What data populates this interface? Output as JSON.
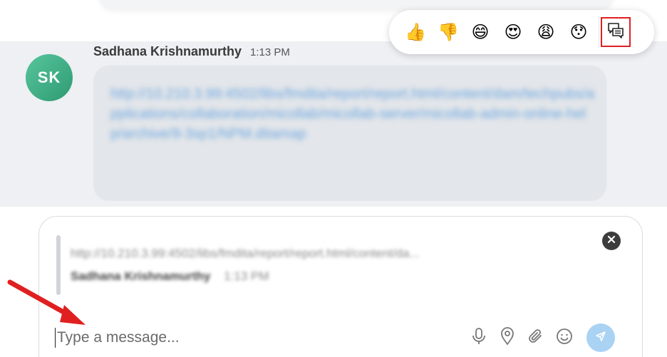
{
  "message": {
    "avatar_initials": "SK",
    "sender_name": "Sadhana Krishnamurthy",
    "time": "1:13 PM",
    "link_text": "http://10.210.3.99:4502/libs/fmdita/report/report.html/content/dam/techpubs/applications/collaboration/micollab/micollab-server/micollab-admin-online-help/archive/9-3sp1/NPM.ditamap"
  },
  "reactions": {
    "items": [
      {
        "name": "thumbs-up",
        "glyph": "👍"
      },
      {
        "name": "thumbs-down",
        "glyph": "👎"
      },
      {
        "name": "grinning",
        "glyph": "😄"
      },
      {
        "name": "heart-eyes",
        "glyph": "😍"
      },
      {
        "name": "weary",
        "glyph": "😩"
      },
      {
        "name": "hushed",
        "glyph": "😯"
      }
    ],
    "reply_icon": "reply-thread-icon",
    "highlight_color": "#e02020"
  },
  "composer": {
    "quote_text": "http://10.210.3.99:4502/libs/fmdita/report/report.html/content/da...",
    "quote_name": "Sadhana Krishnamurthy",
    "quote_time": "1:13 PM",
    "placeholder": "Type a message...",
    "value": "",
    "tool_icons": [
      "microphone-icon",
      "location-pin-icon",
      "paperclip-icon",
      "smiley-icon"
    ],
    "send_color": "#a9d2f3"
  },
  "colors": {
    "avatar": "#3aa882",
    "message_row_bg": "#eef0f3",
    "bubble_bg": "#e3e6ea",
    "link": "#6fa8e0",
    "annotation_arrow": "#e02020"
  }
}
